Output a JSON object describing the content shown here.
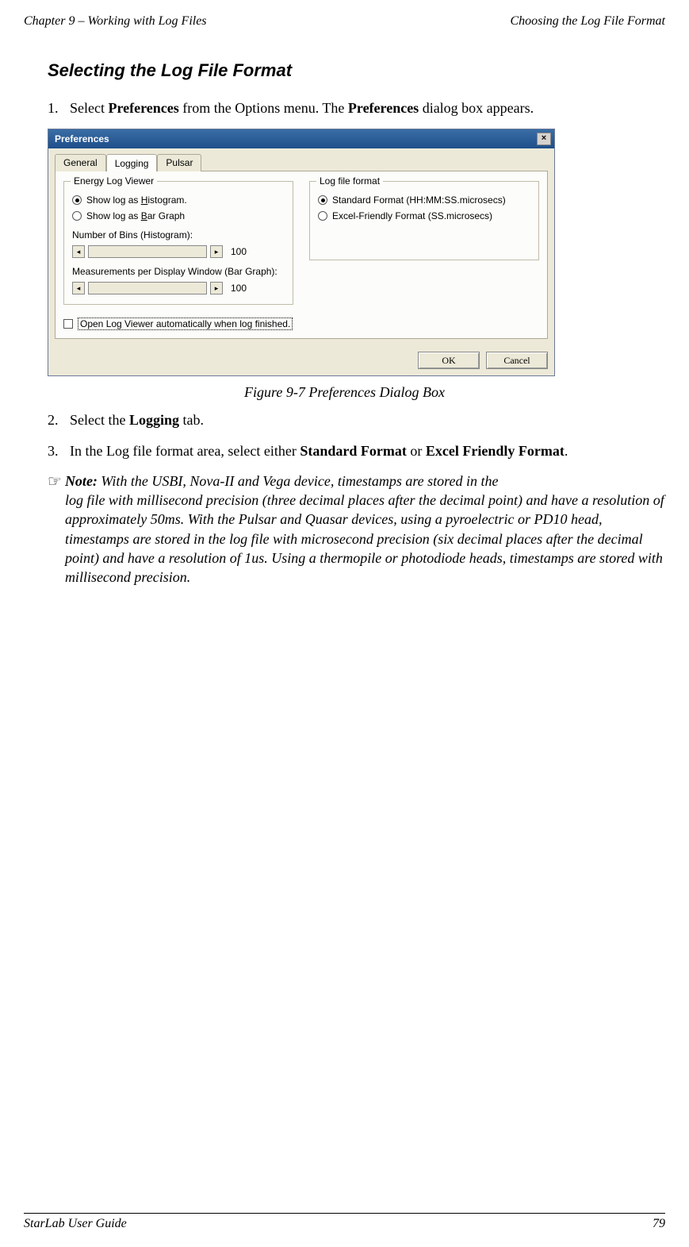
{
  "header": {
    "left": "Chapter 9 – Working with Log Files",
    "right": "Choosing the Log File Format"
  },
  "section_title": "Selecting the Log File Format",
  "steps": {
    "s1_num": "1.",
    "s1_a": "Select ",
    "s1_b": "Preferences",
    "s1_c": " from the Options menu. The ",
    "s1_d": "Preferences",
    "s1_e": " dialog box appears.",
    "s2_num": "2.",
    "s2_a": "Select the ",
    "s2_b": "Logging",
    "s2_c": " tab.",
    "s3_num": "3.",
    "s3_a": "In the Log file format area, select either ",
    "s3_b": "Standard Format",
    "s3_c": " or ",
    "s3_d": "Excel Friendly Format",
    "s3_e": "."
  },
  "figure_caption": "Figure 9-7 Preferences Dialog Box",
  "note": {
    "icon": "☞",
    "label": "Note:",
    "body_first": " With the USBI, Nova-II and Vega device, timestamps are stored in the",
    "body_rest": "log file with millisecond precision (three decimal places after the decimal point) and have a resolution of approximately 50ms. With the Pulsar and Quasar devices, using a pyroelectric or PD10 head, timestamps are stored in the log file with microsecond precision (six decimal places after the decimal point) and have a resolution of 1us. Using a thermopile or photodiode heads, timestamps are stored with millisecond precision."
  },
  "dialog": {
    "title": "Preferences",
    "close": "×",
    "tabs": {
      "general": "General",
      "logging": "Logging",
      "pulsar": "Pulsar"
    },
    "group_energy": {
      "legend": "Energy Log Viewer",
      "opt_hist_pre": "Show log as ",
      "opt_hist_ul": "H",
      "opt_hist_post": "istogram.",
      "opt_bar_pre": "Show log as ",
      "opt_bar_ul": "B",
      "opt_bar_post": "ar Graph",
      "bins_label": "Number of Bins (Histogram):",
      "bins_val": "100",
      "meas_label": "Measurements per Display Window (Bar Graph):",
      "meas_val": "100"
    },
    "group_format": {
      "legend": "Log file format",
      "std": "Standard Format (HH:MM:SS.microsecs)",
      "excel": "Excel-Friendly Format (SS.microsecs)"
    },
    "autoopen": "Open Log Viewer automatically when log finished.",
    "ok": "OK",
    "cancel": "Cancel"
  },
  "footer": {
    "left": "StarLab User Guide",
    "right": "79"
  }
}
